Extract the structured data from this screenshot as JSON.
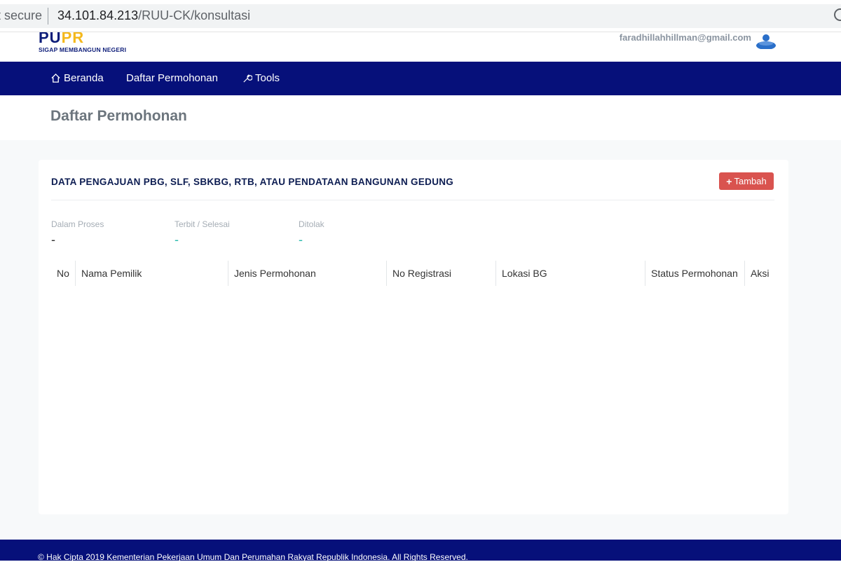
{
  "browser": {
    "security_label": "t secure",
    "url_host": "34.101.84.213",
    "url_path": "/RUU-CK/konsultasi"
  },
  "header": {
    "logo_text_a": "PU",
    "logo_text_b": "PR",
    "logo_tagline": "SIGAP MEMBANGUN NEGERI",
    "user_email": "faradhillahhillman@gmail.com"
  },
  "nav": {
    "items": [
      {
        "label": "Beranda",
        "icon": "home-icon"
      },
      {
        "label": "Daftar Permohonan",
        "icon": ""
      },
      {
        "label": "Tools",
        "icon": "wrench-icon"
      }
    ]
  },
  "page": {
    "title": "Daftar Permohonan"
  },
  "card": {
    "title": "DATA PENGAJUAN PBG, SLF, SBKBG, RTB, ATAU PENDATAAN BANGUNAN GEDUNG",
    "add_label": "Tambah",
    "stats": [
      {
        "label": "Dalam Proses",
        "value": "-",
        "color": "#333333"
      },
      {
        "label": "Terbit / Selesai",
        "value": "-",
        "color": "#2bbbad"
      },
      {
        "label": "Ditolak",
        "value": "-",
        "color": "#2bbbad"
      }
    ],
    "table_columns": [
      "No",
      "Nama Pemilik",
      "Jenis Permohonan",
      "No Registrasi",
      "Lokasi BG",
      "Status Permohonan",
      "Aksi"
    ]
  },
  "footer": {
    "copyright": "© Hak Cipta 2019 Kementerian Pekerjaan Umum Dan Perumahan Rakyat Republik Indonesia. All Rights Reserved."
  },
  "colors": {
    "navbar": "#06107a",
    "accent_button": "#d9534f",
    "logo_yellow": "#f4b81c"
  }
}
